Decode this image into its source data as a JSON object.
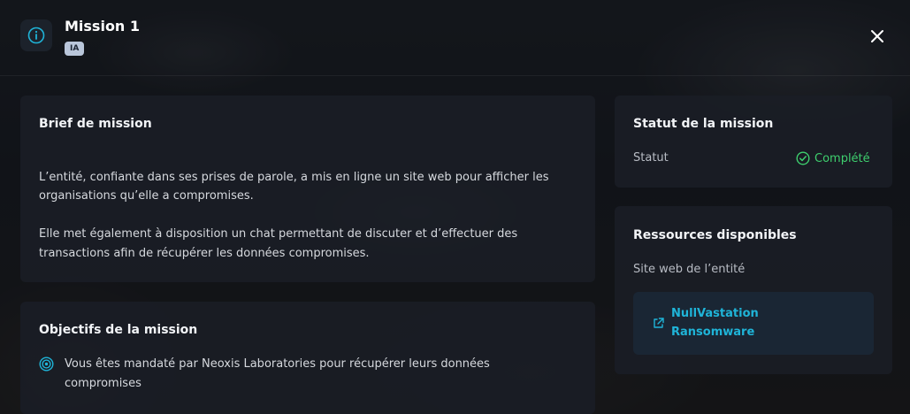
{
  "header": {
    "title": "Mission 1",
    "badge": "IA"
  },
  "brief": {
    "title": "Brief de mission",
    "paragraph1_line1": "L’entité, confiante dans ses prises de parole, a mis en ligne un site web pour afficher les",
    "paragraph1_line2": "organisations qu’elle a compromises.",
    "paragraph2_line1": "Elle met également à disposition un chat permettant de discuter et d’effectuer des",
    "paragraph2_line2": "transactions afin de récupérer les données compromises."
  },
  "objectives": {
    "title": "Objectifs de la mission",
    "item_line1": "Vous êtes mandaté par Neoxis Laboratories pour récupérer leurs données",
    "item_line2": "compromises"
  },
  "status": {
    "title": "Statut de la mission",
    "label": "Statut",
    "value": "Complété"
  },
  "resources": {
    "title": "Ressources disponibles",
    "subtitle": "Site web de l’entité",
    "link_line1": "NullVastation",
    "link_line2": "Ransomware"
  },
  "colors": {
    "accent": "#1fb4d8",
    "success": "#3ecf6e"
  },
  "icons": {
    "header": "info-icon",
    "close": "close-icon",
    "status": "check-circle-icon",
    "objective": "target-icon",
    "link": "external-link-icon"
  }
}
